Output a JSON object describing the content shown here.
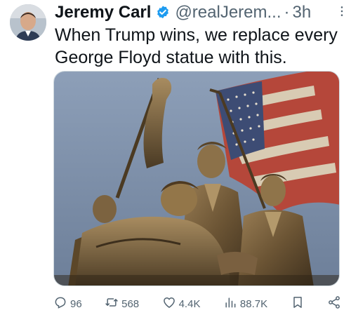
{
  "author": {
    "name": "Jeremy Carl",
    "handle": "@realJerem...",
    "time": "3h"
  },
  "tweet": {
    "text_line1": "When Trump wins, we replace every",
    "text_line2": "George Floyd statue with this."
  },
  "actions": {
    "replies": "96",
    "retweets": "568",
    "likes": "4.4K",
    "views": "88.7K"
  },
  "icons": {
    "verified": "verified-badge-icon",
    "more": "more-dots-icon",
    "reply": "reply-icon",
    "retweet": "retweet-icon",
    "like": "heart-icon",
    "views": "views-icon",
    "bookmark": "bookmark-icon",
    "share": "share-icon"
  },
  "colors": {
    "text_primary": "#0f1419",
    "text_secondary": "#536471",
    "verified_blue": "#1d9bf0"
  }
}
